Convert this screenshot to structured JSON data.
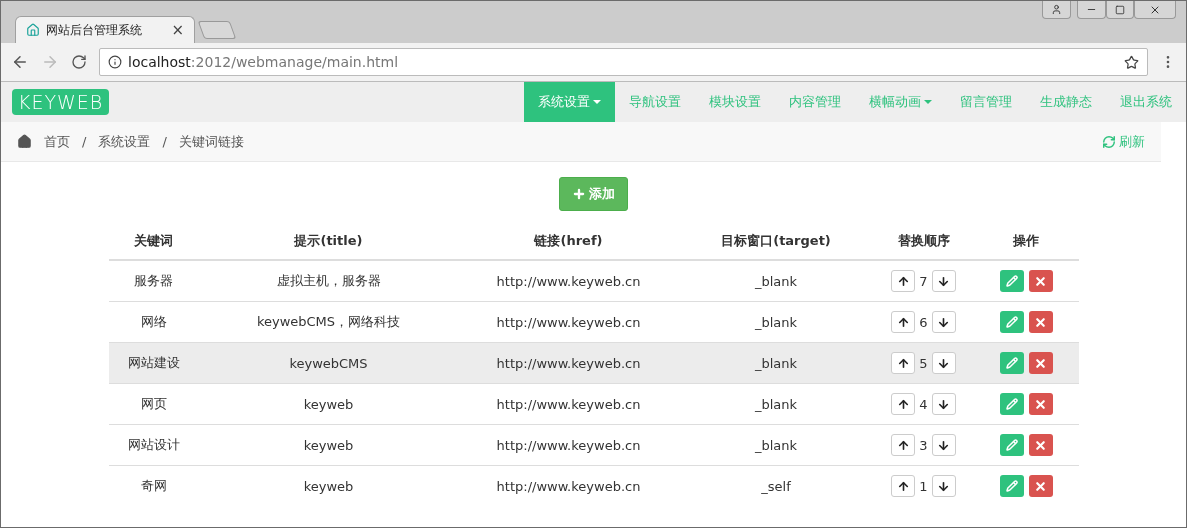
{
  "browser": {
    "tab_title": "网站后台管理系统",
    "tab_close": "×",
    "url_host": "localhost",
    "url_path": ":2012/webmanage/main.html"
  },
  "logo": "KEYWEB",
  "nav": [
    {
      "label": "系统设置",
      "selected": true,
      "dropdown": true
    },
    {
      "label": "导航设置",
      "selected": false,
      "dropdown": false
    },
    {
      "label": "模块设置",
      "selected": false,
      "dropdown": false
    },
    {
      "label": "内容管理",
      "selected": false,
      "dropdown": false
    },
    {
      "label": "横幅动画",
      "selected": false,
      "dropdown": true
    },
    {
      "label": "留言管理",
      "selected": false,
      "dropdown": false
    },
    {
      "label": "生成静态",
      "selected": false,
      "dropdown": false
    },
    {
      "label": "退出系统",
      "selected": false,
      "dropdown": false
    }
  ],
  "breadcrumb": [
    "首页",
    "系统设置",
    "关键词链接"
  ],
  "breadcrumb_separator": "/",
  "refresh": "刷新",
  "add_button": "添加",
  "table": {
    "columns": [
      "关键词",
      "提示(title)",
      "链接(href)",
      "目标窗口(target)",
      "替换顺序",
      "操作"
    ],
    "rows": [
      {
        "keyword": "服务器",
        "title": "虚拟主机，服务器",
        "href": "http://www.keyweb.cn",
        "target": "_blank",
        "order": "7",
        "highlighted": false
      },
      {
        "keyword": "网络",
        "title": "keywebCMS，网络科技",
        "href": "http://www.keyweb.cn",
        "target": "_blank",
        "order": "6",
        "highlighted": false
      },
      {
        "keyword": "网站建设",
        "title": "keywebCMS",
        "href": "http://www.keyweb.cn",
        "target": "_blank",
        "order": "5",
        "highlighted": true
      },
      {
        "keyword": "网页",
        "title": "keyweb",
        "href": "http://www.keyweb.cn",
        "target": "_blank",
        "order": "4",
        "highlighted": false
      },
      {
        "keyword": "网站设计",
        "title": "keyweb",
        "href": "http://www.keyweb.cn",
        "target": "_blank",
        "order": "3",
        "highlighted": false
      },
      {
        "keyword": "奇网",
        "title": "keyweb",
        "href": "http://www.keyweb.cn",
        "target": "_self",
        "order": "1",
        "highlighted": false
      }
    ]
  }
}
